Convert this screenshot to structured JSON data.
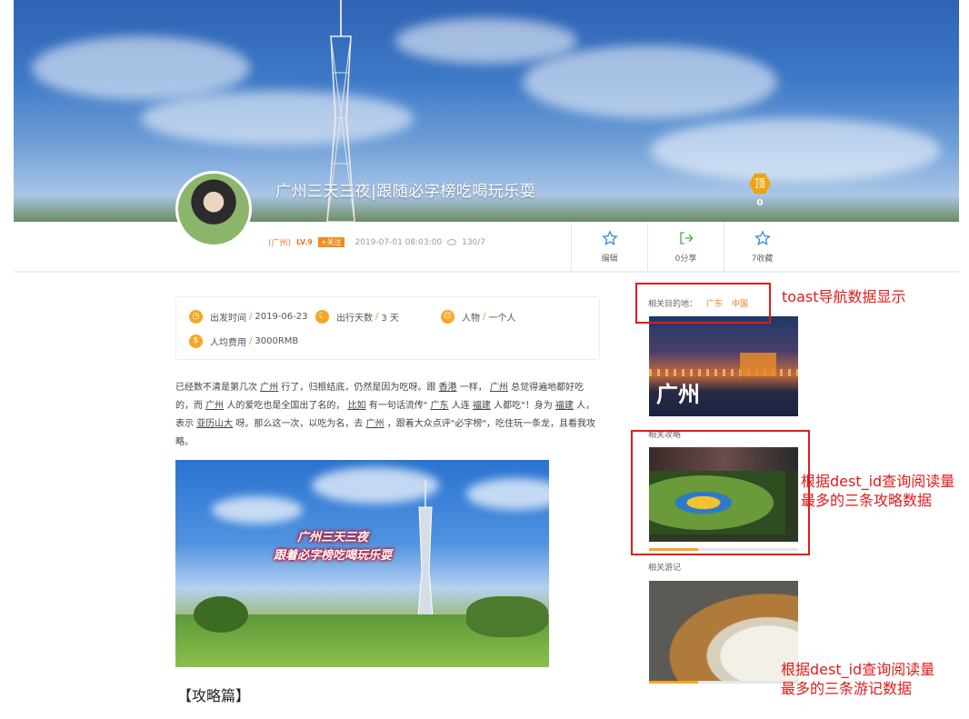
{
  "header": {
    "title": "广州三天三夜|跟随必字榜吃喝玩乐耍",
    "top_label": "顶",
    "top_count": "0"
  },
  "author": {
    "location": "(广州)",
    "level": "LV.9",
    "follow": "+关注",
    "datetime": "2019-07-01 08:03:00",
    "views": "130/7"
  },
  "actions": [
    {
      "label": "编辑",
      "icon": "star-outline-icon"
    },
    {
      "label": "0分享",
      "icon": "share-icon"
    },
    {
      "label": "7收藏",
      "icon": "star-outline-icon"
    }
  ],
  "facts": {
    "depart": {
      "label": "出发时间",
      "value": "2019-06-23"
    },
    "days": {
      "label": "出行天数",
      "value": "3 天"
    },
    "people": {
      "label": "人物",
      "value": "一个人"
    },
    "cost": {
      "label": "人均费用",
      "value": "3000RMB"
    }
  },
  "intro": {
    "p1": "已经数不清是第几次",
    "l1": "广州",
    "p2": "行了，归根结底，仍然是因为吃呀。跟",
    "l2": "香港",
    "p3": "一样，",
    "l3": "广州",
    "p4": "总觉得遍地都好吃的，而",
    "l4": "广州",
    "p5": "人的爱吃也是全国出了名的，",
    "l5": "比如",
    "p6": "有一句话流传\"",
    "l6": "广东",
    "p7": "人连",
    "l7": "福建",
    "p8": "人都吃\"！身为",
    "l8": "福建",
    "p9": "人，表示",
    "l9": "亚历山大",
    "p10": "呀。那么这一次，以吃为名，去",
    "l10": "广州",
    "p11": "，跟着大众点评\"必字榜\"，吃住玩一条龙，且看我攻略。"
  },
  "content_image": {
    "line1": "广州三天三夜",
    "line2": "跟着必字榜吃喝玩乐耍"
  },
  "section_title": "【攻略篇】",
  "sidebar": {
    "dest_label": "相关目的地：",
    "dest_tags": [
      "广东",
      "中国"
    ],
    "city_name": "广州",
    "related_guides": "相关攻略",
    "related_notes": "相关游记"
  },
  "annotations": {
    "toast": "toast导航数据显示",
    "guides_line1": "根据dest_id查询阅读量",
    "guides_line2": "最多的三条攻略数据",
    "notes_line1": "根据dest_id查询阅读量",
    "notes_line2": "最多的三条游记数据"
  },
  "colors": {
    "accent": "#f5a623",
    "link_orange": "#f07a20",
    "annotation_red": "#e11b1b"
  }
}
